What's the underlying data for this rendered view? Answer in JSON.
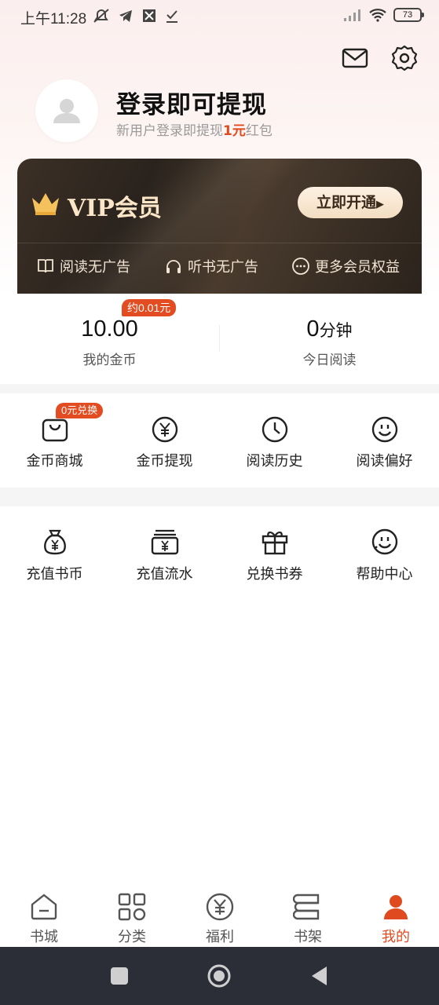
{
  "status_bar": {
    "time": "上午11:28",
    "battery": "73"
  },
  "header": {
    "mail_icon": "mail-icon",
    "settings_icon": "gear-icon"
  },
  "profile": {
    "title": "登录即可提现",
    "subtitle_prefix": "新用户登录即提现",
    "subtitle_amount": "1元",
    "subtitle_suffix": "红包"
  },
  "vip": {
    "title": "VIP会员",
    "button": "立即开通",
    "perks": [
      "阅读无广告",
      "听书无广告",
      "更多会员权益"
    ],
    "accent_color": "#fbe6c8"
  },
  "stats": {
    "coins_value": "10.00",
    "coins_label": "我的金币",
    "coins_badge": "约0.01元",
    "reading_value": "0",
    "reading_unit": "分钟",
    "reading_label": "今日阅读"
  },
  "menu1": [
    {
      "label": "金币商城",
      "icon": "shopping-bag-icon",
      "badge": "0元兑换"
    },
    {
      "label": "金币提现",
      "icon": "yuan-coin-icon"
    },
    {
      "label": "阅读历史",
      "icon": "clock-icon"
    },
    {
      "label": "阅读偏好",
      "icon": "smiley-icon"
    }
  ],
  "menu2": [
    {
      "label": "充值书币",
      "icon": "money-bag-icon"
    },
    {
      "label": "充值流水",
      "icon": "wallet-icon"
    },
    {
      "label": "兑换书券",
      "icon": "gift-icon"
    },
    {
      "label": "帮助中心",
      "icon": "support-icon"
    }
  ],
  "bottom_nav": [
    {
      "label": "书城",
      "icon": "home-icon",
      "active": false
    },
    {
      "label": "分类",
      "icon": "category-icon",
      "active": false
    },
    {
      "label": "福利",
      "icon": "yuan-circle-icon",
      "active": false
    },
    {
      "label": "书架",
      "icon": "bookshelf-icon",
      "active": false
    },
    {
      "label": "我的",
      "icon": "person-icon",
      "active": true
    }
  ],
  "colors": {
    "accent": "#e04a1f",
    "nav_bar": "#2b2e36"
  }
}
